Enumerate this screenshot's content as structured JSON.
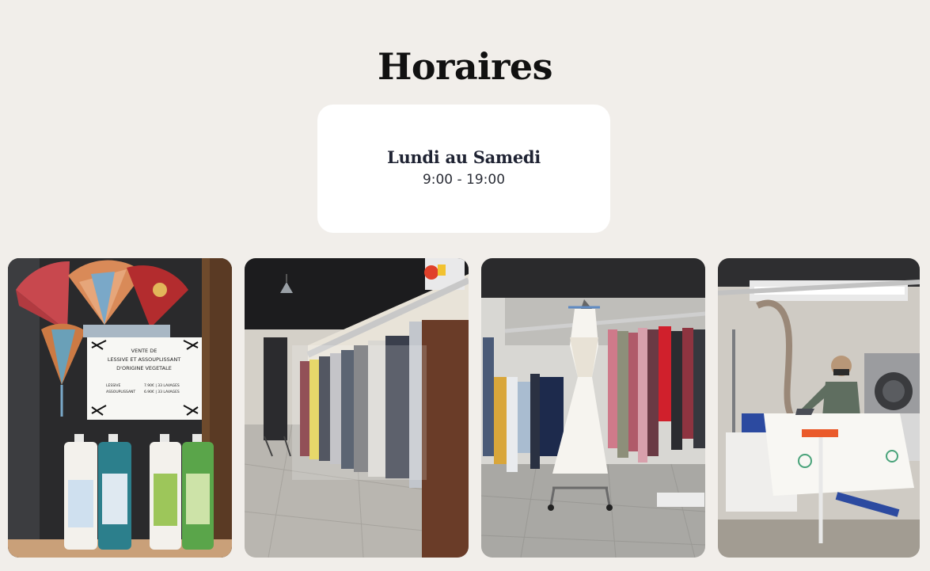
{
  "section": {
    "title": "Horaires"
  },
  "hours_card": {
    "days": "Lundi au Samedi",
    "hours": "9:00 - 19:00"
  },
  "gallery": {
    "photos": [
      {
        "subject": "shop-window-detergent-display",
        "sign": {
          "line1": "VENTE DE",
          "line2": "LESSIVE ET ASSOUPLISSANT",
          "line3": "D'ORIGINE VEGETALE",
          "row1_label": "LESSIVE",
          "row1_value": "7.90€ | 33 LAVAGES",
          "row2_label": "ASSOUPLISSANT",
          "row2_value": "6.90€ | 33 LAVAGES"
        }
      },
      {
        "subject": "garment-conveyor-rail"
      },
      {
        "subject": "wedding-dress-on-rack"
      },
      {
        "subject": "man-ironing-tablecloth"
      }
    ]
  },
  "colors": {
    "background": "#f1eeea",
    "card": "#ffffff",
    "title": "#111111",
    "text": "#1f2333"
  }
}
